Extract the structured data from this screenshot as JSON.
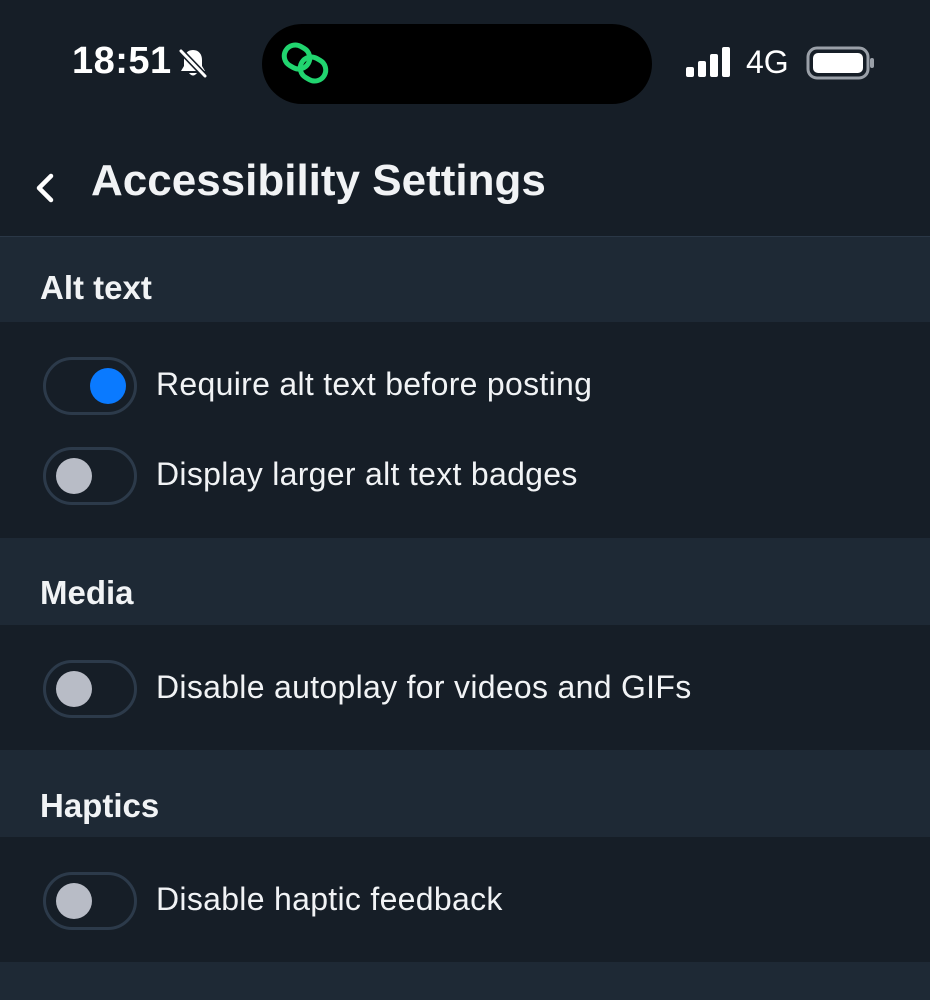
{
  "status_bar": {
    "time": "18:51",
    "network": "4G",
    "icons": [
      "bell-slash-icon",
      "link-icon",
      "signal-icon",
      "battery-icon"
    ]
  },
  "header": {
    "back_icon": "chevron-left-icon",
    "title": "Accessibility Settings"
  },
  "sections": [
    {
      "title": "Alt text",
      "items": [
        {
          "label": "Require alt text before posting",
          "enabled": true
        },
        {
          "label": "Display larger alt text badges",
          "enabled": false
        }
      ]
    },
    {
      "title": "Media",
      "items": [
        {
          "label": "Disable autoplay for videos and GIFs",
          "enabled": false
        }
      ]
    },
    {
      "title": "Haptics",
      "items": [
        {
          "label": "Disable haptic feedback",
          "enabled": false
        }
      ]
    }
  ],
  "colors": {
    "background": "#161e27",
    "section_header": "#1e2935",
    "accent": "#0a7aff",
    "toggle_off_knob": "#b8bcc6",
    "island_icon": "#21d46f"
  }
}
